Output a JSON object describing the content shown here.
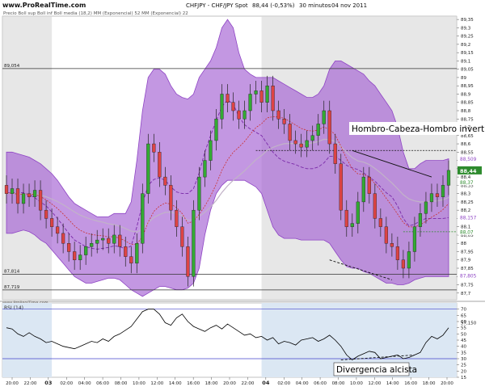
{
  "header": {
    "brand": "www.ProRealTime.com",
    "title": "CHFJPY - CHF/JPY Spot",
    "quote": "88,44 (-0,53%)",
    "timeframe": "30 minutos",
    "date": "04 nov 2011",
    "legend_line": "Precio Boll sup Boll inf Boll media (18,2) MM (Exponencial) 52 MM (Exponencial) 22"
  },
  "colors": {
    "bollinger_fill": "#a35fd2",
    "bollinger_edge": "#8e44c4",
    "bull_candle": "#33aa33",
    "bear_candle": "#dd4444",
    "mm52": "#c2b3c8",
    "mm22": "#cc3333",
    "boll_mid": "#7a2aa8",
    "bg_shade": "#d7d7d7",
    "rsi_line": "#000000",
    "rsi_bg": "#dbe7f3",
    "last_price_bg": "#2e8b2e",
    "annotation_box_bg": "#ffffff"
  },
  "chart_data": {
    "type": "candlestick",
    "price_axis": {
      "range": [
        87.66,
        89.37
      ],
      "tick_labels": [
        "89,35",
        "89,3",
        "89,25",
        "89,2",
        "89,15",
        "89,1",
        "89,05",
        "89",
        "88,95",
        "88,9",
        "88,85",
        "88,8",
        "88,75",
        "88,7",
        "88,65",
        "88,6",
        "88,55",
        "88,5",
        "88,45",
        "88,4",
        "88,35",
        "88,3",
        "88,25",
        "88,2",
        "88,15",
        "88,1",
        "88,05",
        "88",
        "87,95",
        "87,9",
        "87,85",
        "87,8",
        "87,75",
        "87,7"
      ],
      "tick_values": [
        89.35,
        89.3,
        89.25,
        89.2,
        89.15,
        89.1,
        89.05,
        89.0,
        88.95,
        88.9,
        88.85,
        88.8,
        88.75,
        88.7,
        88.65,
        88.6,
        88.55,
        88.5,
        88.45,
        88.4,
        88.35,
        88.3,
        88.25,
        88.2,
        88.15,
        88.1,
        88.05,
        88.0,
        87.95,
        87.9,
        87.85,
        87.8,
        87.75,
        87.7
      ],
      "last_price": 88.44,
      "last_price_label": "88,44"
    },
    "price_levels": [
      {
        "label": "89,054",
        "value": 89.054
      },
      {
        "label": "87,814",
        "value": 87.814
      },
      {
        "label": "87,719",
        "value": 87.719
      }
    ],
    "right_markers": [
      {
        "label": "88,509",
        "value": 88.509,
        "color": "#8e44c4"
      },
      {
        "label": "88,157",
        "value": 88.157,
        "color": "#8e44c4"
      },
      {
        "label": "87,805",
        "value": 87.805,
        "color": "#8e44c4"
      },
      {
        "label": "88,37",
        "value": 88.37,
        "color": "#2e8b2e"
      },
      {
        "label": "88,07",
        "value": 88.07,
        "color": "#2e8b2e"
      }
    ],
    "x_axis": {
      "tick_labels": [
        "20:00",
        "22:00",
        "03",
        "02:00",
        "04:00",
        "06:00",
        "08:00",
        "10:00",
        "12:00",
        "14:00",
        "16:00",
        "18:00",
        "20:00",
        "22:00",
        "04",
        "02:00",
        "04:00",
        "06:00",
        "08:00",
        "10:00",
        "12:00",
        "14:00",
        "16:00",
        "18:00",
        "20:00"
      ],
      "day_labels": [
        "03",
        "04"
      ]
    },
    "series": {
      "close": [
        88.3,
        88.33,
        88.24,
        88.3,
        88.28,
        88.32,
        88.2,
        88.15,
        88.1,
        88.06,
        88.0,
        87.95,
        87.9,
        87.93,
        87.98,
        88.0,
        88.02,
        88.03,
        88.0,
        88.05,
        87.98,
        87.92,
        87.88,
        88.0,
        88.3,
        88.6,
        88.55,
        88.4,
        88.35,
        88.2,
        88.1,
        87.98,
        87.8,
        88.2,
        88.4,
        88.5,
        88.62,
        88.75,
        88.9,
        88.85,
        88.8,
        88.75,
        88.8,
        88.9,
        88.92,
        88.85,
        88.95,
        88.8,
        88.75,
        88.72,
        88.62,
        88.6,
        88.58,
        88.62,
        88.65,
        88.72,
        88.8,
        88.6,
        88.48,
        88.2,
        88.1,
        88.12,
        88.25,
        88.4,
        88.3,
        88.15,
        88.1,
        88.0,
        87.98,
        87.9,
        87.85,
        87.95,
        88.1,
        88.18,
        88.25,
        88.3,
        88.28,
        88.35,
        88.44
      ],
      "open": [
        88.35,
        88.3,
        88.33,
        88.24,
        88.3,
        88.28,
        88.32,
        88.2,
        88.15,
        88.1,
        88.06,
        88.0,
        87.95,
        87.9,
        87.93,
        87.98,
        88.0,
        88.02,
        88.03,
        88.0,
        88.05,
        87.98,
        87.92,
        87.88,
        88.0,
        88.3,
        88.6,
        88.55,
        88.4,
        88.35,
        88.2,
        88.1,
        87.98,
        87.8,
        88.2,
        88.4,
        88.5,
        88.62,
        88.75,
        88.9,
        88.85,
        88.8,
        88.75,
        88.8,
        88.9,
        88.92,
        88.85,
        88.95,
        88.8,
        88.75,
        88.72,
        88.62,
        88.6,
        88.58,
        88.62,
        88.65,
        88.72,
        88.8,
        88.6,
        88.48,
        88.2,
        88.1,
        88.12,
        88.25,
        88.4,
        88.3,
        88.15,
        88.1,
        88.0,
        87.98,
        87.9,
        87.85,
        87.95,
        88.1,
        88.18,
        88.25,
        88.3,
        88.28,
        88.35
      ],
      "bollinger_upper": [
        88.55,
        88.55,
        88.54,
        88.53,
        88.52,
        88.5,
        88.48,
        88.45,
        88.42,
        88.38,
        88.33,
        88.28,
        88.24,
        88.22,
        88.2,
        88.18,
        88.16,
        88.16,
        88.16,
        88.18,
        88.18,
        88.18,
        88.25,
        88.5,
        88.8,
        89.0,
        89.05,
        89.05,
        89.02,
        88.95,
        88.9,
        88.88,
        88.87,
        88.9,
        89.0,
        89.05,
        89.1,
        89.18,
        89.3,
        89.35,
        89.3,
        89.15,
        89.05,
        89.02,
        89.0,
        89.0,
        89.0,
        89.0,
        88.98,
        88.96,
        88.94,
        88.92,
        88.9,
        88.88,
        88.88,
        88.9,
        88.95,
        89.05,
        89.1,
        89.1,
        89.08,
        89.06,
        89.04,
        89.02,
        88.98,
        88.95,
        88.9,
        88.85,
        88.8,
        88.7,
        88.55,
        88.45,
        88.45,
        88.48,
        88.5,
        88.5,
        88.5,
        88.5,
        88.51
      ],
      "bollinger_lower": [
        88.06,
        88.06,
        88.07,
        88.08,
        88.07,
        88.05,
        88.02,
        88.0,
        87.96,
        87.92,
        87.88,
        87.84,
        87.8,
        87.78,
        87.76,
        87.76,
        87.77,
        87.78,
        87.79,
        87.79,
        87.78,
        87.75,
        87.72,
        87.7,
        87.68,
        87.7,
        87.72,
        87.74,
        87.74,
        87.73,
        87.72,
        87.72,
        87.73,
        87.76,
        87.85,
        88.05,
        88.2,
        88.3,
        88.35,
        88.38,
        88.38,
        88.38,
        88.38,
        88.36,
        88.34,
        88.3,
        88.2,
        88.1,
        88.05,
        88.03,
        88.03,
        88.03,
        88.02,
        88.02,
        88.02,
        88.02,
        88.02,
        88.0,
        87.95,
        87.9,
        87.86,
        87.85,
        87.85,
        87.83,
        87.82,
        87.8,
        87.78,
        87.76,
        87.76,
        87.75,
        87.75,
        87.76,
        87.78,
        87.79,
        87.8,
        87.8,
        87.8,
        87.8,
        87.8
      ]
    },
    "rsi": {
      "label": "RSI (14)",
      "range": [
        15,
        75
      ],
      "tick_labels": [
        "70",
        "65",
        "60",
        "55",
        "50",
        "45",
        "40",
        "35",
        "30",
        "25",
        "20",
        "15"
      ],
      "tick_values": [
        70,
        65,
        60,
        55,
        50,
        45,
        40,
        35,
        30,
        25,
        20,
        15
      ],
      "upper_level": 70,
      "lower_level": 30,
      "right_label": "57,150",
      "values": [
        55,
        54,
        50,
        48,
        51,
        48,
        46,
        43,
        44,
        42,
        40,
        39,
        38,
        40,
        42,
        44,
        43,
        46,
        44,
        48,
        50,
        53,
        56,
        62,
        68,
        70,
        70,
        66,
        59,
        57,
        63,
        66,
        60,
        56,
        54,
        52,
        55,
        57,
        54,
        58,
        55,
        52,
        49,
        50,
        47,
        48,
        45,
        47,
        42,
        44,
        43,
        41,
        45,
        46,
        47,
        44,
        46,
        49,
        45,
        40,
        33,
        29,
        32,
        34,
        36,
        35,
        30,
        31,
        32,
        33,
        30,
        31,
        33,
        35,
        43,
        48,
        46,
        49,
        55
      ]
    },
    "annotations": [
      {
        "label": "Hombro-Cabeza-Hombro invertido",
        "target": "price"
      },
      {
        "label": "Divergencia alcista",
        "target": "rsi"
      }
    ]
  }
}
